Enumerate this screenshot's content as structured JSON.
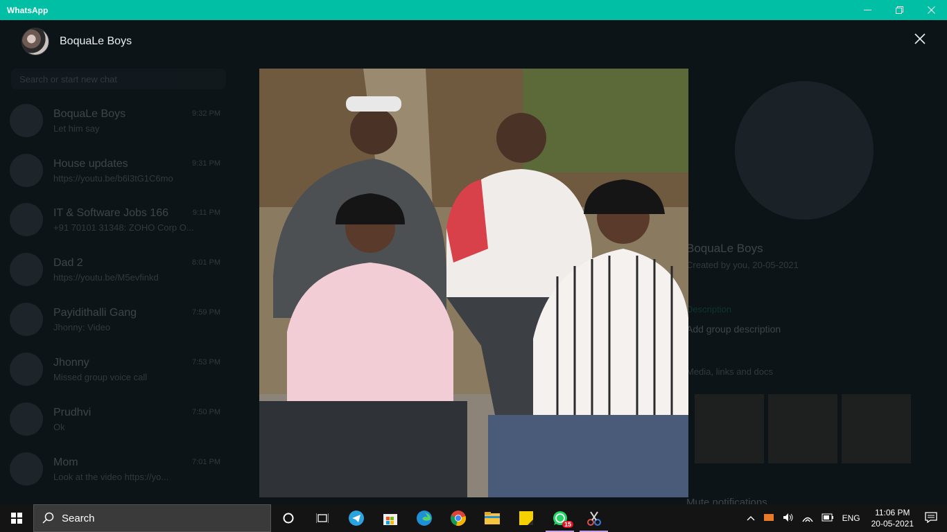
{
  "window": {
    "app_title": "WhatsApp"
  },
  "viewer": {
    "group_name": "BoquaLe Boys"
  },
  "background": {
    "search_placeholder": "Search or start new chat",
    "chats": [
      {
        "name": "BoquaLe Boys",
        "preview": "Let him say",
        "time": "9:32 PM"
      },
      {
        "name": "House updates",
        "preview": "https://youtu.be/b6l3tG1C6mo",
        "time": "9:31 PM"
      },
      {
        "name": "IT & Software Jobs 166",
        "preview": "+91 70101 31348: ZOHO Corp O...",
        "time": "9:11 PM"
      },
      {
        "name": "Dad 2",
        "preview": "https://youtu.be/M5evfinkd",
        "time": "8:01 PM"
      },
      {
        "name": "Payidithalli Gang",
        "preview": "Jhonny: Video",
        "time": "7:59 PM"
      },
      {
        "name": "Jhonny",
        "preview": "Missed group voice call",
        "time": "7:53 PM"
      },
      {
        "name": "Prudhvi",
        "preview": "Ok",
        "time": "7:50 PM"
      },
      {
        "name": "Mom",
        "preview": "Look at the video https://yo...",
        "time": "7:01 PM"
      }
    ],
    "info": {
      "group_name": "BoquaLe Boys",
      "subtitle": "Created by you, 20-05-2021",
      "desc_label": "Description",
      "desc_value": "Add group description",
      "media_label": "Media, links and docs",
      "mute_label": "Mute notifications"
    }
  },
  "taskbar": {
    "search_label": "Search",
    "whatsapp_badge": "15",
    "language": "ENG",
    "time": "11:06 PM",
    "date": "20-05-2021"
  }
}
